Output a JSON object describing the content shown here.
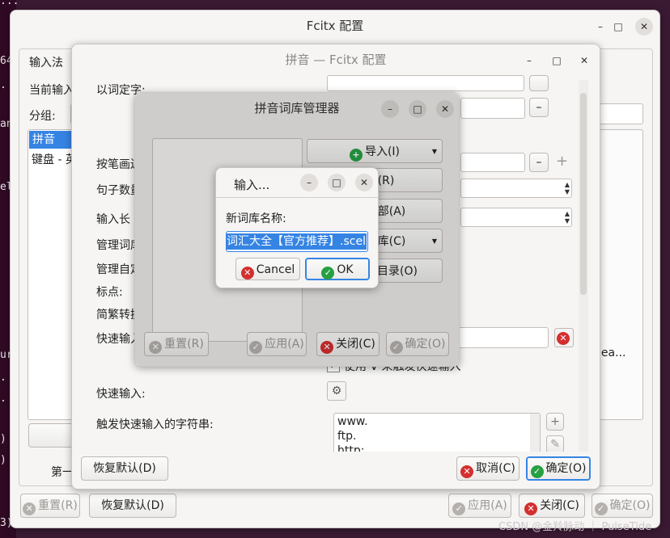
{
  "terminal": {
    "lines": [
      "...",
      "64",
      ".",
      "",
      "an",
      "",
      "el",
      "ur",
      ".",
      ".",
      ")",
      ")",
      "",
      "3) ..."
    ]
  },
  "main_window": {
    "title": "Fcitx 配置",
    "tab_input_method": "输入法",
    "current_input_label": "当前输入",
    "group_label": "分组:",
    "list_items": [
      "拼音",
      "键盘 - 英"
    ],
    "first_label": "第一",
    "buttons": {
      "reset": "重置(R)",
      "restore_default": "恢复默认(D)",
      "apply": "应用(A)",
      "close": "关闭(C)",
      "ok": "确定(O)"
    },
    "ellipsis_text": "dea..."
  },
  "pinyin_window": {
    "title": "拼音 — Fcitx 配置",
    "labels": [
      "以词定字:",
      "按笔画边",
      "句子数量",
      "输入长",
      "管理词库",
      "管理自定",
      "标点:",
      "简繁转换",
      "快速输入",
      "快速输入:",
      "触发快速输入的字符串:"
    ],
    "checkbox_text": "使用 V 来触发快速输入",
    "trigger_list": [
      "www.",
      "ftp.",
      "http:"
    ],
    "buttons": {
      "restore_default": "恢复默认(D)",
      "cancel": "取消(C)",
      "ok": "确定(O)"
    }
  },
  "dict_manager": {
    "title": "拼音词库管理器",
    "buttons": {
      "import": "导入(I)",
      "delete": "删除(R)",
      "clear_all": "清空全部(A)",
      "user_dict": "用户词库(C)",
      "open_dir": "打开数据目录(O)",
      "reset": "重置(R)",
      "apply": "应用(A)",
      "close": "关闭(C)",
      "ok": "确定(O)"
    }
  },
  "input_dialog": {
    "title": "输入...",
    "prompt": "新词库名称:",
    "value": "词汇大全【官方推荐】.scel",
    "cancel": "Cancel",
    "ok": "OK"
  },
  "watermark": "CSDN @金羚脉动 ｜ PulseTide",
  "colors": {
    "selection": "#3584e4",
    "close_red": "#d32f2f",
    "ok_green": "#26a042"
  }
}
